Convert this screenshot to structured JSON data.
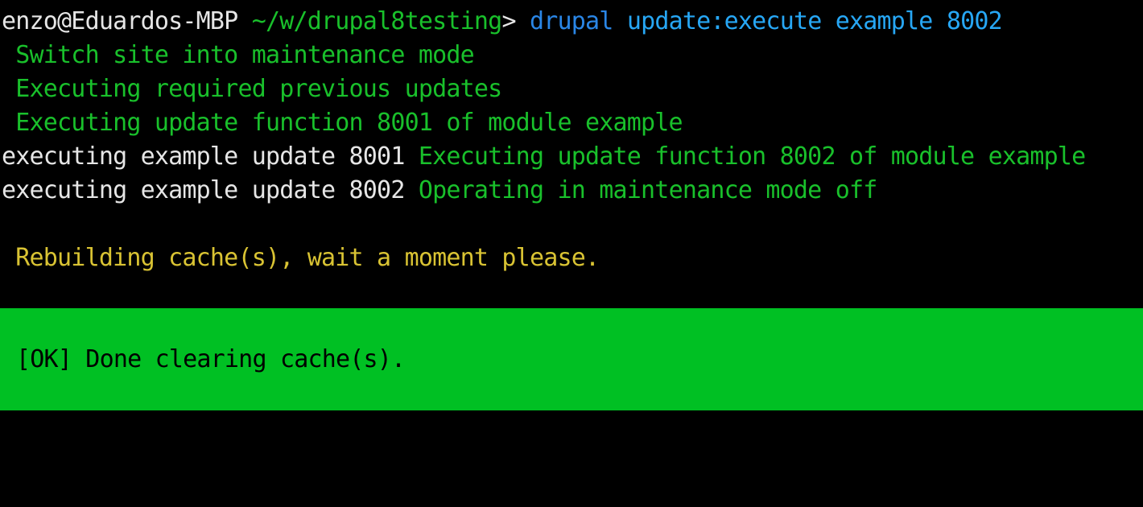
{
  "prompt": {
    "user_host": "enzo@Eduardos-MBP",
    "path": "~/w/drupal8testing",
    "symbol": ">",
    "command": "drupal",
    "args": "update:execute example 8002"
  },
  "output": {
    "line1": " Switch site into maintenance mode",
    "line2": " Executing required previous updates",
    "line3": " Executing update function 8001 of module example",
    "line4_prefix": "executing example update 8001",
    "line4_message": " Executing update function 8002 of module example",
    "line5_prefix": "executing example update 8002",
    "line5_message": " Operating in maintenance mode off",
    "cache_message": " Rebuilding cache(s), wait a moment please."
  },
  "result": {
    "text": "[OK] Done clearing cache(s)."
  },
  "colors": {
    "background": "#000000",
    "prompt_text": "#e6e6e6",
    "path": "#19c02b",
    "command": "#2a86e6",
    "args": "#27a7f5",
    "success_text": "#19c02b",
    "warning_text": "#d9c333",
    "ok_block_background": "#00c023",
    "ok_block_text": "#000000"
  }
}
